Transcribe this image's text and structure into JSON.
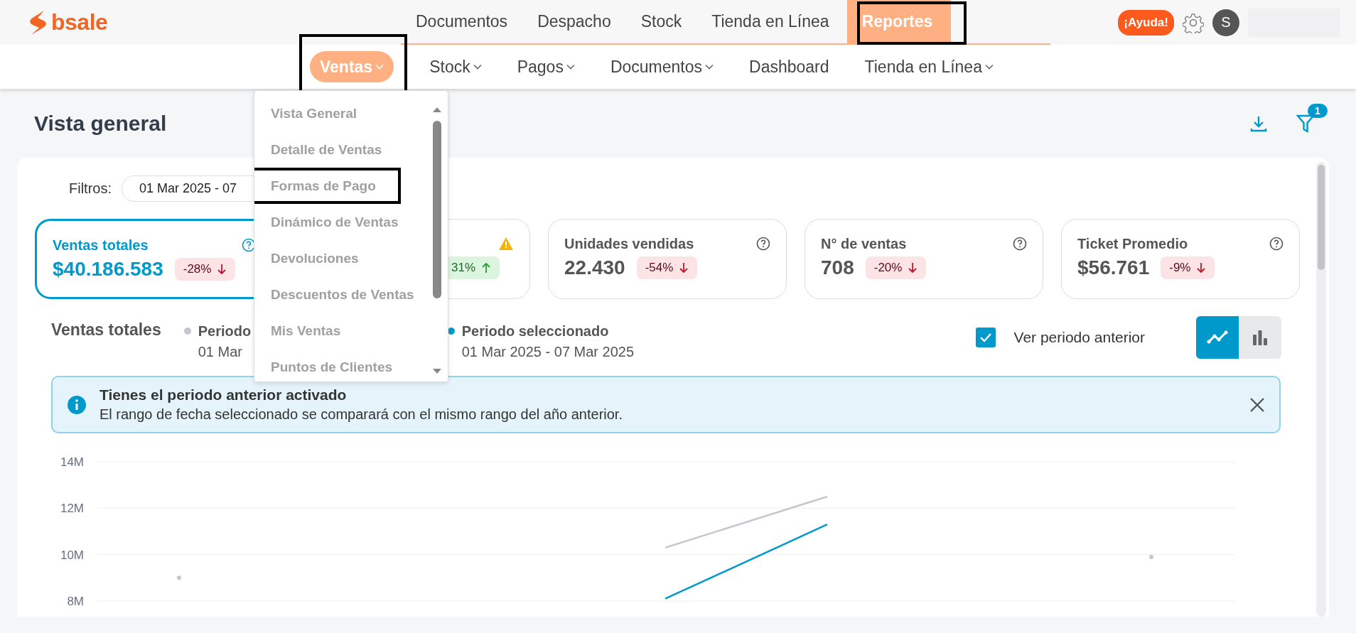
{
  "logo": {
    "text": "bsale"
  },
  "top_nav": [
    {
      "label": "Documentos",
      "selected": false,
      "highlighted": false
    },
    {
      "label": "Despacho",
      "selected": false,
      "highlighted": false
    },
    {
      "label": "Stock",
      "selected": false,
      "highlighted": false
    },
    {
      "label": "Tienda en Línea",
      "selected": false,
      "highlighted": false
    },
    {
      "label": "Reportes",
      "selected": true,
      "highlighted": true
    }
  ],
  "help_button": "¡Ayuda!",
  "avatar": "S",
  "sub_nav": [
    {
      "label": "Ventas",
      "selected": true,
      "caret": true,
      "highlighted": true
    },
    {
      "label": "Stock",
      "selected": false,
      "caret": true,
      "highlighted": false
    },
    {
      "label": "Pagos",
      "selected": false,
      "caret": true,
      "highlighted": false
    },
    {
      "label": "Documentos",
      "selected": false,
      "caret": true,
      "highlighted": false
    },
    {
      "label": "Dashboard",
      "selected": false,
      "caret": false,
      "highlighted": false
    },
    {
      "label": "Tienda en Línea",
      "selected": false,
      "caret": true,
      "highlighted": false
    }
  ],
  "dropdown": {
    "items": [
      {
        "label": "Vista General",
        "highlighted": false
      },
      {
        "label": "Detalle de Ventas",
        "highlighted": false
      },
      {
        "label": "Formas de Pago",
        "highlighted": true
      },
      {
        "label": "Dinámico de Ventas",
        "highlighted": false
      },
      {
        "label": "Devoluciones",
        "highlighted": false
      },
      {
        "label": "Descuentos de Ventas",
        "highlighted": false
      },
      {
        "label": "Mis Ventas",
        "highlighted": false
      },
      {
        "label": "Puntos de Clientes",
        "highlighted": false
      }
    ]
  },
  "page": {
    "title": "Vista general",
    "filter_count": "1"
  },
  "filters": {
    "label": "Filtros:",
    "date_range": "01 Mar 2025 - 07"
  },
  "kpis": [
    {
      "kind": "help",
      "title": "Ventas totales",
      "value": "$40.186.583",
      "change": "-28%",
      "rising": false,
      "selected": true
    },
    {
      "kind": "warning",
      "change": "31%",
      "rising": true,
      "selected": false
    },
    {
      "kind": "help",
      "title": "Unidades vendidas",
      "value": "22.430",
      "change": "-54%",
      "rising": false,
      "selected": false
    },
    {
      "kind": "help",
      "title": "N° de ventas",
      "value": "708",
      "change": "-20%",
      "rising": false,
      "selected": false
    },
    {
      "kind": "help",
      "title": "Ticket Promedio",
      "value": "$56.761",
      "change": "-9%",
      "rising": false,
      "selected": false
    }
  ],
  "chart_header": {
    "title": "Ventas totales",
    "legend_ranges": [
      "01 Mar",
      "01 Mar 2025 - 07 Mar 2025"
    ],
    "compare": {
      "label": "Ver periodo anterior",
      "checked": true
    },
    "views": [
      {
        "kind": "line",
        "selected": true
      },
      {
        "kind": "bar",
        "selected": false
      }
    ]
  },
  "alert": {
    "title": "Tienes el periodo anterior activado",
    "text": "El rango de fecha seleccionado se comparará con el mismo rango del año anterior."
  },
  "chart_data": {
    "type": "line",
    "ylim": [
      8,
      14
    ],
    "grid": true,
    "yticks": [
      {
        "value": 8,
        "label": "8M"
      },
      {
        "value": 10,
        "label": "10M"
      },
      {
        "value": 12,
        "label": "12M"
      },
      {
        "value": 14,
        "label": "14M"
      }
    ],
    "series": [
      {
        "name": "Periodo",
        "color": "#c8c5cf",
        "values": [
          9.0,
          null,
          null,
          10.3,
          12.5,
          null,
          9.9
        ]
      },
      {
        "name": "Periodo seleccionado",
        "color": "#0099cc",
        "values": [
          null,
          null,
          null,
          8.1,
          11.3,
          null,
          null
        ]
      }
    ]
  }
}
